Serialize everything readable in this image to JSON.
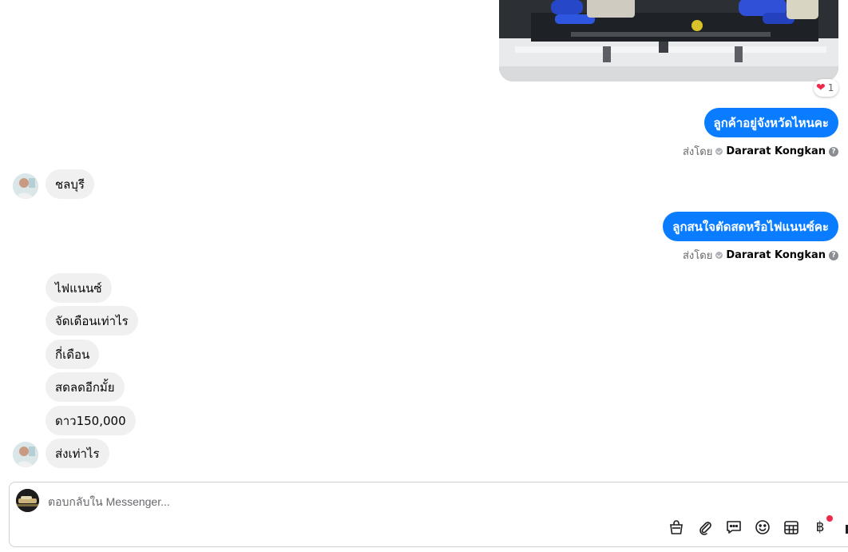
{
  "attachment": {
    "reaction": {
      "icon": "heart-icon",
      "count": "1"
    }
  },
  "messages": [
    {
      "direction": "outgoing",
      "text": "ลูกค้าอยู่จังหวัดไหนคะ",
      "sent_by_prefix": "ส่งโดย",
      "sent_by": "Dararat Kongkan"
    },
    {
      "direction": "incoming",
      "text": "ชลบุรี"
    },
    {
      "direction": "outgoing",
      "text": "ลูกสนใจตัดสดหรือไฟแนนซ์คะ",
      "sent_by_prefix": "ส่งโดย",
      "sent_by": "Dararat Kongkan"
    },
    {
      "direction": "incoming",
      "text": "ไฟแนนซ์"
    },
    {
      "direction": "incoming",
      "text": "จัดเดือนเท่าไร"
    },
    {
      "direction": "incoming",
      "text": "กี่เดือน"
    },
    {
      "direction": "incoming",
      "text": "สดลดอีกมั้ย"
    },
    {
      "direction": "incoming",
      "text": "ดาว150,000"
    },
    {
      "direction": "incoming",
      "text": "ส่งเท่าไร"
    }
  ],
  "composer": {
    "placeholder": "ตอบกลับใน Messenger...",
    "value": "",
    "tools": [
      "shop-bag-icon",
      "paperclip-icon",
      "saved-reply-icon",
      "emoji-icon",
      "calendar-table-icon",
      "baht-payment-icon"
    ],
    "baht_symbol": "฿"
  },
  "colors": {
    "outgoing_bubble": "#0a7cff",
    "incoming_bubble": "#f0f0f0",
    "notification_dot": "#f02849"
  }
}
